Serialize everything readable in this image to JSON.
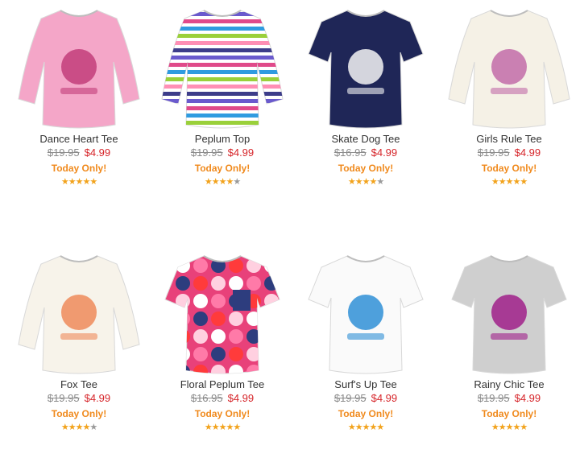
{
  "products": [
    {
      "name": "Dance Heart Tee",
      "old_price": "$19.95",
      "price": "$4.99",
      "promo": "Today Only!",
      "rating": 5,
      "icon": "pink-dance-heart-tee-image",
      "shirt": {
        "body": "#f4a6c8",
        "accent": "#c23d7a",
        "sleeve": "long"
      }
    },
    {
      "name": "Peplum Top",
      "old_price": "$19.95",
      "price": "$4.99",
      "promo": "Today Only!",
      "rating": 4,
      "icon": "striped-peplum-top-image",
      "shirt": {
        "body": "#ffffff",
        "accent": "#7a5cc8",
        "sleeve": "long",
        "stripes": [
          "#6a5acd",
          "#e04a8a",
          "#2f9be0",
          "#9ad03a",
          "#ff8fb5",
          "#3d3d8a"
        ]
      }
    },
    {
      "name": "Skate Dog Tee",
      "old_price": "$16.95",
      "price": "$4.99",
      "promo": "Today Only!",
      "rating": 4,
      "icon": "navy-skate-dog-tee-image",
      "shirt": {
        "body": "#1f2657",
        "accent": "#f4f4f4",
        "sleeve": "short"
      }
    },
    {
      "name": "Girls Rule Tee",
      "old_price": "$19.95",
      "price": "$4.99",
      "promo": "Today Only!",
      "rating": 5,
      "icon": "cream-girls-rule-tee-image",
      "shirt": {
        "body": "#f5f1e6",
        "accent": "#c26ca8",
        "sleeve": "long"
      }
    },
    {
      "name": "Fox Tee",
      "old_price": "$19.95",
      "price": "$4.99",
      "promo": "Today Only!",
      "rating": 4,
      "icon": "cream-fox-tee-image",
      "shirt": {
        "body": "#f7f3ea",
        "accent": "#ee8a5a",
        "sleeve": "long"
      }
    },
    {
      "name": "Floral Peplum Tee",
      "old_price": "$16.95",
      "price": "$4.99",
      "promo": "Today Only!",
      "rating": 5,
      "icon": "floral-peplum-tee-image",
      "shirt": {
        "body": "#e8417a",
        "accent": "#2d3d7e",
        "sleeve": "short",
        "floral": true
      }
    },
    {
      "name": "Surf's Up Tee",
      "old_price": "$19.95",
      "price": "$4.99",
      "promo": "Today Only!",
      "rating": 5,
      "icon": "white-surfs-up-tee-image",
      "shirt": {
        "body": "#fafafa",
        "accent": "#2f8fd6",
        "sleeve": "short"
      }
    },
    {
      "name": "Rainy Chic Tee",
      "old_price": "$19.95",
      "price": "$4.99",
      "promo": "Today Only!",
      "rating": 5,
      "icon": "grey-rainy-chic-tee-image",
      "shirt": {
        "body": "#cfcfcf",
        "accent": "#a0208a",
        "sleeve": "short"
      }
    }
  ]
}
